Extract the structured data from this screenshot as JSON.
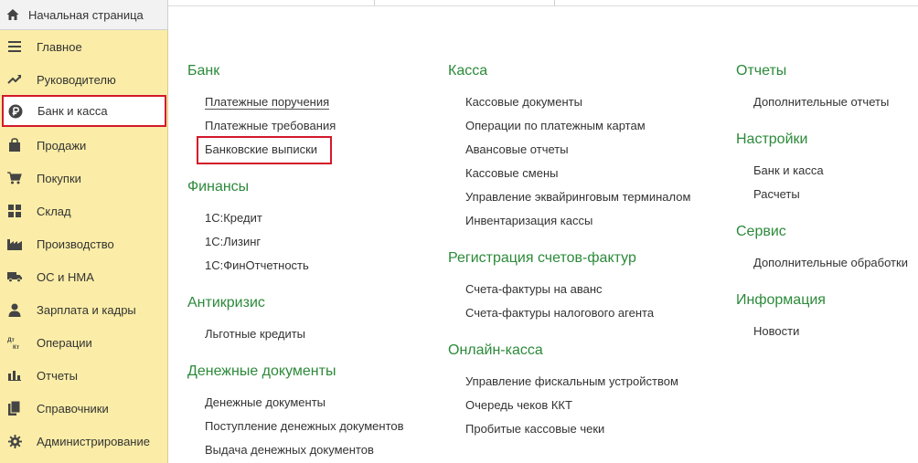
{
  "home": {
    "label": "Начальная страница",
    "icon": "home-icon"
  },
  "sidebar": {
    "items": [
      {
        "label": "Главное",
        "icon": "menu-lines-icon"
      },
      {
        "label": "Руководителю",
        "icon": "trend-up-icon"
      },
      {
        "label": "Банк и касса",
        "icon": "ruble-coin-icon",
        "active": true
      },
      {
        "label": "Продажи",
        "icon": "shopping-bag-icon"
      },
      {
        "label": "Покупки",
        "icon": "cart-icon"
      },
      {
        "label": "Склад",
        "icon": "warehouse-grid-icon"
      },
      {
        "label": "Производство",
        "icon": "factory-icon"
      },
      {
        "label": "ОС и НМА",
        "icon": "truck-icon"
      },
      {
        "label": "Зарплата и кадры",
        "icon": "person-icon"
      },
      {
        "label": "Операции",
        "icon": "debit-credit-icon",
        "icon_text": "Дт Кт"
      },
      {
        "label": "Отчеты",
        "icon": "bar-chart-icon"
      },
      {
        "label": "Справочники",
        "icon": "books-icon"
      },
      {
        "label": "Администрирование",
        "icon": "gear-icon"
      }
    ]
  },
  "columns": [
    {
      "groups": [
        {
          "title": "Банк",
          "links": [
            "Платежные поручения",
            "Платежные требования",
            "Банковские выписки"
          ]
        },
        {
          "title": "Финансы",
          "links": [
            "1С:Кредит",
            "1С:Лизинг",
            "1С:ФинОтчетность"
          ]
        },
        {
          "title": "Антикризис",
          "links": [
            "Льготные кредиты"
          ]
        },
        {
          "title": "Денежные документы",
          "links": [
            "Денежные документы",
            "Поступление денежных документов",
            "Выдача денежных документов"
          ]
        }
      ]
    },
    {
      "groups": [
        {
          "title": "Касса",
          "links": [
            "Кассовые документы",
            "Операции по платежным картам",
            "Авансовые отчеты",
            "Кассовые смены",
            "Управление эквайринговым терминалом",
            "Инвентаризация кассы"
          ]
        },
        {
          "title": "Регистрация счетов-фактур",
          "links": [
            "Счета-фактуры на аванс",
            "Счета-фактуры налогового агента"
          ]
        },
        {
          "title": "Онлайн-касса",
          "links": [
            "Управление фискальным устройством",
            "Очередь чеков ККТ",
            "Пробитые кассовые чеки"
          ]
        }
      ]
    },
    {
      "groups": [
        {
          "title": "Отчеты",
          "links": [
            "Дополнительные отчеты"
          ]
        },
        {
          "title": "Настройки",
          "links": [
            "Банк и касса",
            "Расчеты"
          ]
        },
        {
          "title": "Сервис",
          "links": [
            "Дополнительные обработки"
          ]
        },
        {
          "title": "Информация",
          "links": [
            "Новости"
          ]
        }
      ]
    }
  ],
  "colors": {
    "accent_green": "#2c8a3a",
    "sidebar_bg": "#fbeda7",
    "highlight_red": "#d3192a"
  }
}
